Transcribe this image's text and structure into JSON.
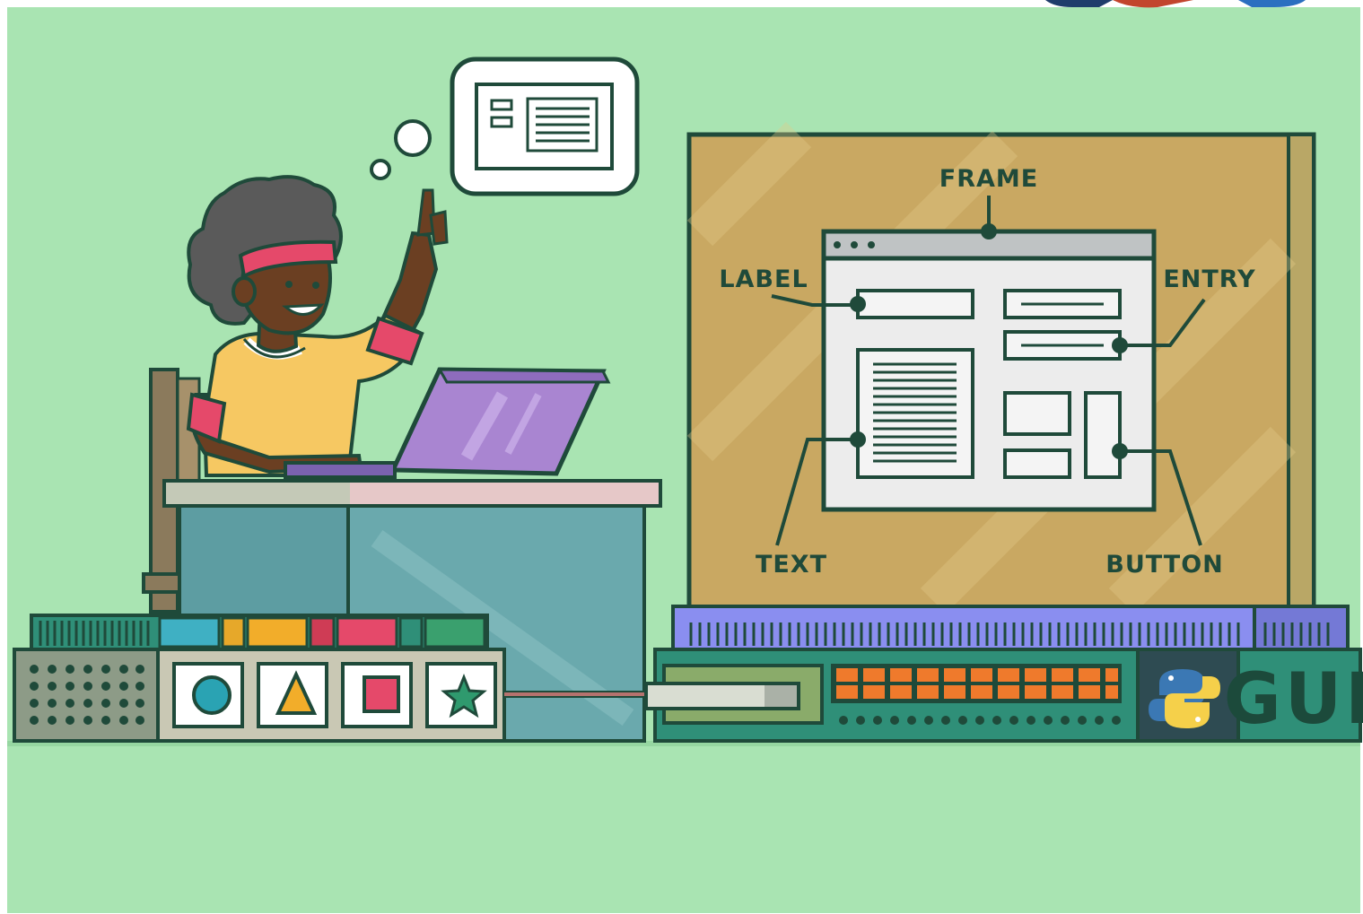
{
  "diagram": {
    "labels": {
      "frame": "FRAME",
      "label": "LABEL",
      "entry": "ENTRY",
      "text": "TEXT",
      "button": "BUTTON"
    },
    "rack_badge": "GUI"
  },
  "icons": [
    "python-logo-icon",
    "circle-icon",
    "triangle-icon",
    "square-icon",
    "star-icon",
    "thought-bubble-window-icon"
  ],
  "colors": {
    "background": "#a9e4b2",
    "outline": "#1f4a3a",
    "board": "#c9a862",
    "window": "#ececec",
    "laptop": "#a985d1",
    "headband": "#e5496a",
    "shirt": "#f6c862",
    "desk": "#6aa9ad",
    "rack_top": "#8a8ef0",
    "rack_front": "#2f8f78",
    "orange_leds": "#ef7a2c"
  }
}
